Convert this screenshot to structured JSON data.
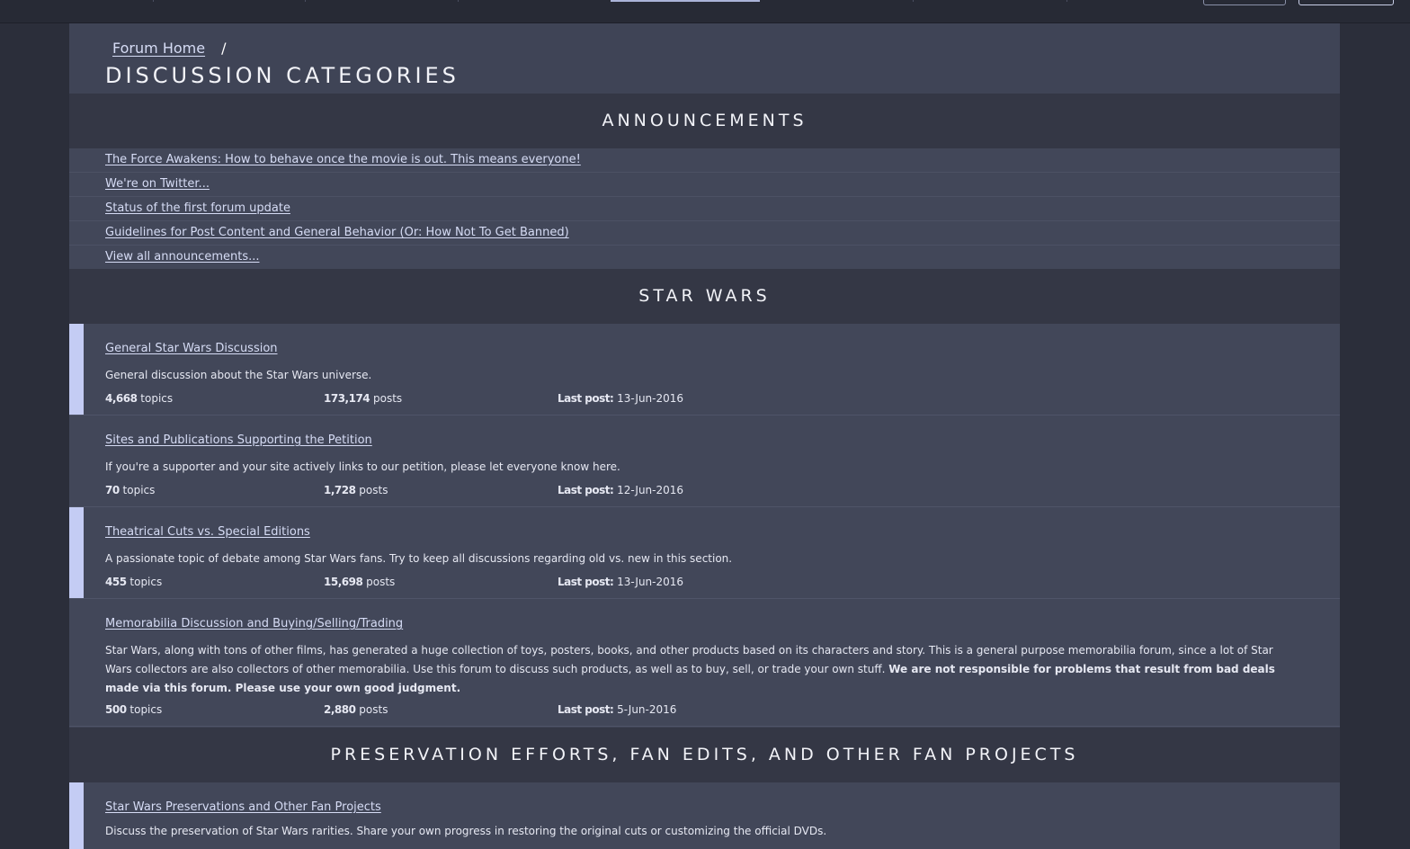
{
  "breadcrumb": {
    "home": "Forum Home",
    "separator": "/"
  },
  "page_title": "DISCUSSION CATEGORIES",
  "sections": [
    {
      "title": "ANNOUNCEMENTS"
    },
    {
      "title": "STAR WARS"
    },
    {
      "title": "PRESERVATION EFFORTS, FAN EDITS, AND OTHER FAN PROJECTS"
    }
  ],
  "announcements": [
    "The Force Awakens: How to behave once the movie is out. This means everyone!",
    "We're on Twitter...",
    "Status of the first forum update",
    "Guidelines for Post Content and General Behavior (Or: How Not To Get Banned)",
    "View all announcements..."
  ],
  "labels": {
    "topics": "topics",
    "posts": "posts",
    "last_post": "Last post:"
  },
  "forums": [
    {
      "title": "General Star Wars Discussion",
      "description": "General discussion about the Star Wars universe.",
      "description_bold": "",
      "topics": "4,668",
      "posts": "173,174",
      "last_post": "13-Jun-2016",
      "accent": true
    },
    {
      "title": "Sites and Publications Supporting the Petition",
      "description": "If you're a supporter and your site actively links to our petition, please let everyone know here.",
      "description_bold": "",
      "topics": "70",
      "posts": "1,728",
      "last_post": "12-Jun-2016",
      "accent": false
    },
    {
      "title": "Theatrical Cuts vs. Special Editions",
      "description": "A passionate topic of debate among Star Wars fans. Try to keep all discussions regarding old vs. new in this section.",
      "description_bold": "",
      "topics": "455",
      "posts": "15,698",
      "last_post": "13-Jun-2016",
      "accent": true
    },
    {
      "title": "Memorabilia Discussion and Buying/Selling/Trading",
      "description": "Star Wars, along with tons of other films, has generated a huge collection of toys, posters, books, and other products based on its characters and story. This is a general purpose memorabilia forum, since a lot of Star Wars collectors are also collectors of other memorabilia. Use this forum to discuss such products, as well as to buy, sell, or trade your own stuff. ",
      "description_bold": "We are not responsible for problems that result from bad deals made via this forum. Please use your own good judgment.",
      "topics": "500",
      "posts": "2,880",
      "last_post": "5-Jun-2016",
      "accent": false
    },
    {
      "title": "Star Wars Preservations and Other Fan Projects",
      "description": "Discuss the preservation of Star Wars rarities. Share your own progress in restoring the original cuts or customizing the official DVDs.",
      "description_bold": "",
      "accent": true
    }
  ],
  "colors": {
    "accent": "#c4ccf4",
    "link": "#d6dcf5",
    "panel": "#424759",
    "section_header": "#343745",
    "background": "#2b2e3a"
  }
}
